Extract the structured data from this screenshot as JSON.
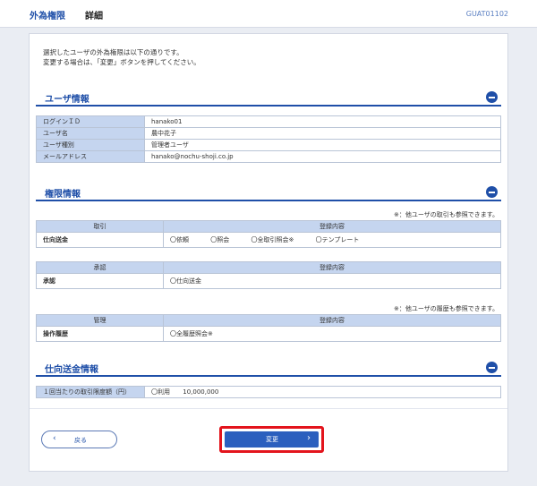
{
  "header": {
    "title": "外為権限",
    "subtitle": "詳細",
    "screen_id": "GUAT01102"
  },
  "intro": {
    "line1": "選択したユーザの外為権限は以下の通りです。",
    "line2": "変更する場合は、「変更」ボタンを押してください。"
  },
  "user_info": {
    "title": "ユーザ情報",
    "rows": [
      {
        "label": "ログインＩＤ",
        "value": "hanako01"
      },
      {
        "label": "ユーザ名",
        "value": "農中花子"
      },
      {
        "label": "ユーザ種別",
        "value": "管理者ユーザ"
      },
      {
        "label": "メールアドレス",
        "value": "hanako@nochu-shoji.co.jp"
      }
    ]
  },
  "permissions": {
    "title": "権限情報",
    "note1": "※：他ユーザの取引も参照できます。",
    "transaction": {
      "col1": "取引",
      "col2": "登録内容",
      "row_label": "仕向送金",
      "options": [
        "〇依頼",
        "〇照会",
        "〇全取引照会※",
        "〇テンプレート"
      ]
    },
    "approval": {
      "col1": "承認",
      "col2": "登録内容",
      "row_label": "承認",
      "options": [
        "〇仕向送金"
      ]
    },
    "note2": "※：他ユーザの履歴も参照できます。",
    "management": {
      "col1": "管理",
      "col2": "登録内容",
      "row_label": "操作履歴",
      "options": [
        "〇全履歴照会※"
      ]
    }
  },
  "remittance": {
    "title": "仕向送金情報",
    "label": "１回当たりの取引限度額（円）",
    "usage": "〇利用",
    "amount": "10,000,000"
  },
  "buttons": {
    "back": "戻る",
    "change": "変更"
  },
  "colors": {
    "accent": "#1f4fa8",
    "header_cell": "#c5d5ef",
    "highlight_border": "#e3141c",
    "primary_button": "#2b5fbe"
  },
  "icons": {
    "collapse": "minus-circle-icon",
    "back": "chevron-left-icon",
    "next": "chevron-right-icon"
  }
}
